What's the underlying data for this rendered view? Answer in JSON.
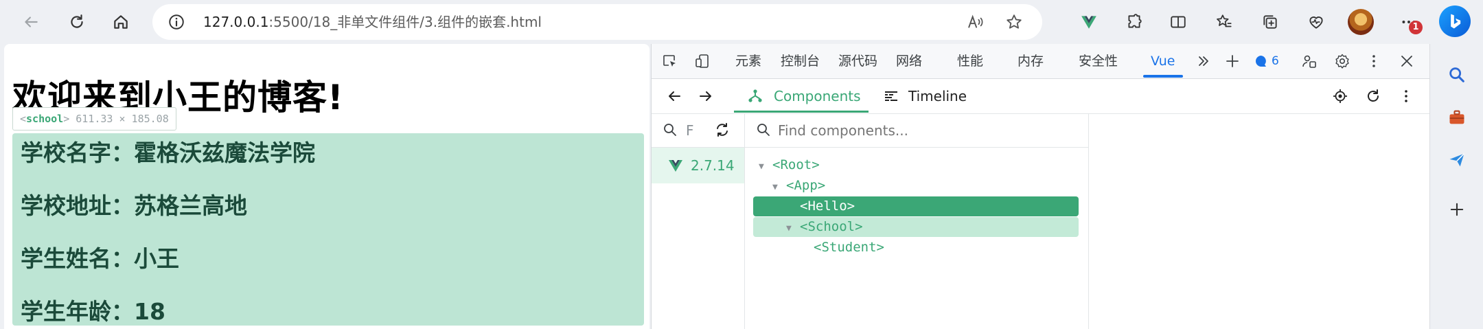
{
  "browser": {
    "address": {
      "host": "127.0.0.1",
      "path": ":5500/18_非单文件组件/3.组件的嵌套.html"
    },
    "notification_count": "1"
  },
  "page": {
    "heading": "欢迎来到小王的博客!",
    "inspect_tooltip": {
      "component": "school",
      "size": "611.33 × 185.08"
    },
    "school": {
      "name_line": "学校名字：霍格沃兹魔法学院",
      "address_line": "学校地址：苏格兰高地",
      "student_name_line": "学生姓名：小王",
      "student_age_line": "学生年龄：18"
    }
  },
  "devtools": {
    "tabs": [
      "元素",
      "控制台",
      "源代码",
      "网络",
      "性能",
      "内存",
      "安全性",
      "Vue"
    ],
    "active_tab": "Vue",
    "message_count": "6",
    "vue": {
      "tabs": {
        "components": "Components",
        "timeline": "Timeline"
      },
      "left_search_hint": "F",
      "app_version": "2.7.14",
      "find_placeholder": "Find components...",
      "tree": [
        {
          "label": "<Root>",
          "expanded": true
        },
        {
          "label": "<App>",
          "expanded": true
        },
        {
          "label": "<Hello>",
          "state": "selected"
        },
        {
          "label": "<School>",
          "expanded": true,
          "state": "hover"
        },
        {
          "label": "<Student>"
        }
      ]
    }
  },
  "colors": {
    "vue_green": "#3ba776",
    "selection_bg": "#3ba776",
    "hover_bg": "#c3ead7",
    "school_highlight": "#bde5d4",
    "active_tab_blue": "#1a73e8"
  }
}
